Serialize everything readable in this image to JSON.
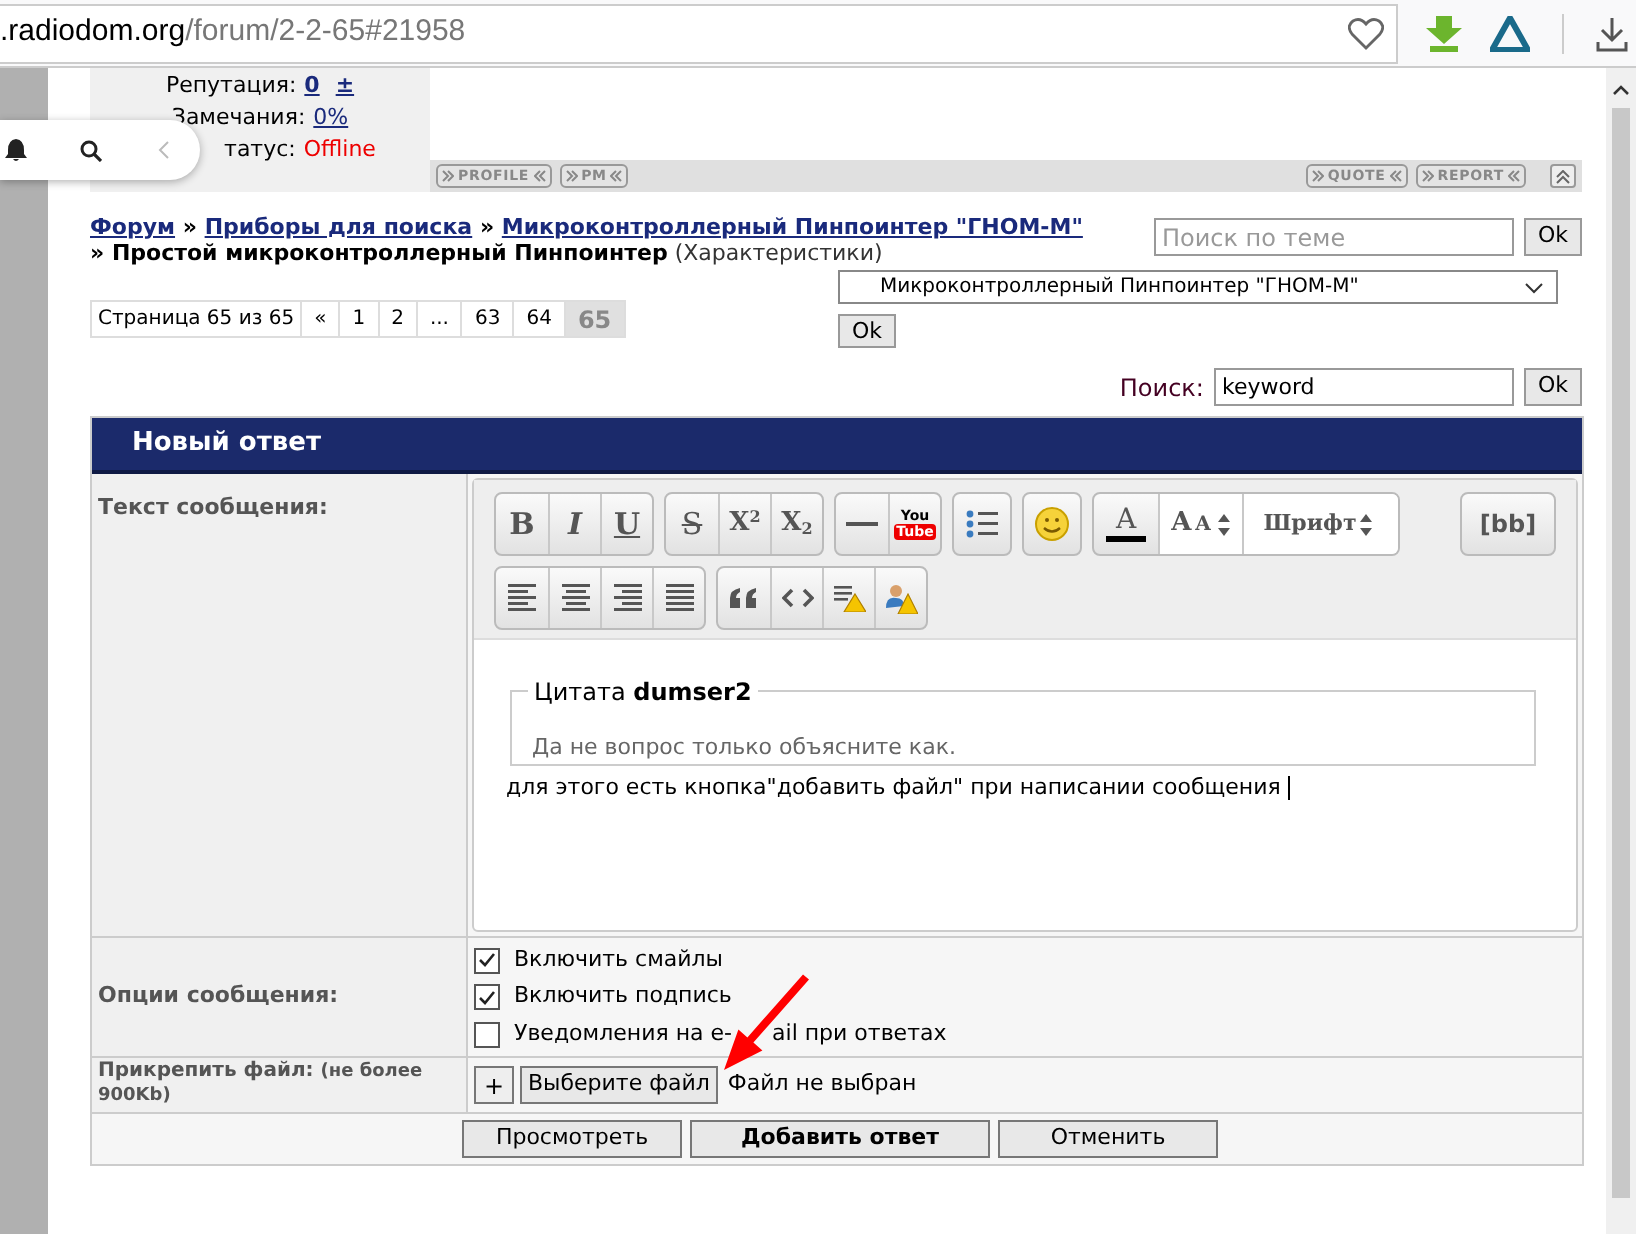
{
  "browser": {
    "url_host": ".radiodom.org",
    "url_path": "/forum/2-2-65#21958"
  },
  "post_profile": {
    "reputation_label": "Репутация:",
    "reputation_value": "0",
    "reputation_action": "±",
    "remarks_label": "Замечания:",
    "remarks_value": "0%",
    "status_label": "татус:",
    "status_value": "Offline",
    "left_buttons": [
      "PROFILE",
      "PM"
    ],
    "right_buttons": [
      "QUOTE",
      "REPORT"
    ]
  },
  "breadcrumb": [
    {
      "text": "Форум",
      "kind": "link"
    },
    {
      "text": "Приборы для поиска",
      "kind": "link"
    },
    {
      "text": "Микроконтроллерный Пинпоинтер \"ГНОМ-М\"",
      "kind": "link"
    },
    {
      "text": "Простой микроконтроллерный Пинпоинтер",
      "kind": "current"
    }
  ],
  "breadcrumb_sep": "»",
  "topic_subtitle": "(Характеристики)",
  "topic_search": {
    "placeholder": "Поиск по теме",
    "button": "Ok"
  },
  "pagination": {
    "label": "Страница 65 из 65",
    "pages": [
      {
        "label": "«",
        "selected": false
      },
      {
        "label": "1",
        "selected": false
      },
      {
        "label": "2",
        "selected": false
      },
      {
        "label": "...",
        "selected": false
      },
      {
        "label": "63",
        "selected": false
      },
      {
        "label": "64",
        "selected": false
      },
      {
        "label": "65",
        "selected": true
      }
    ]
  },
  "forum_jump": {
    "value": "Микроконтроллерный Пинпоинтер \"ГНОМ-М\"",
    "button": "Ok"
  },
  "search": {
    "label": "Поиск:",
    "value": "keyword",
    "button": "Ok"
  },
  "reply_form": {
    "title": "Новый ответ",
    "message_label": "Текст сообщения:",
    "toolbar_rows": [
      [
        [
          {
            "kind": "bold",
            "label": "B"
          },
          {
            "kind": "italic",
            "label": "I"
          },
          {
            "kind": "underline",
            "label": "U"
          }
        ],
        [
          {
            "kind": "strike",
            "label": "S"
          },
          {
            "kind": "sup",
            "label": "X",
            "index": "2"
          },
          {
            "kind": "sub",
            "label": "X",
            "index": "2"
          }
        ],
        [
          {
            "kind": "hr"
          },
          {
            "kind": "youtube",
            "label": "You",
            "label2": "Tube"
          }
        ],
        [
          {
            "kind": "list"
          }
        ],
        [
          {
            "kind": "smiley"
          }
        ],
        [
          {
            "kind": "color",
            "label": "A"
          },
          {
            "kind": "size",
            "label": "A",
            "label2": "A"
          },
          {
            "kind": "font",
            "label": "Шрифт"
          }
        ],
        [
          {
            "kind": "bb",
            "label": "[bb]"
          }
        ]
      ],
      [
        [
          {
            "kind": "align-left"
          },
          {
            "kind": "align-center"
          },
          {
            "kind": "align-right"
          },
          {
            "kind": "justify"
          }
        ],
        [
          {
            "kind": "quote"
          },
          {
            "kind": "code"
          },
          {
            "kind": "warn-text"
          },
          {
            "kind": "warn-user"
          }
        ]
      ]
    ],
    "quote": {
      "label": "Цитата",
      "author": "dumser2",
      "text": "Да не вопрос только объясните как."
    },
    "message_text": "для этого есть кнопка\"добавить файл\" при написании сообщения",
    "options_label": "Опции сообщения:",
    "options": [
      {
        "label": "Включить смайлы",
        "checked": true
      },
      {
        "label": "Включить подпись",
        "checked": true
      },
      {
        "label": "Уведомления на e-",
        "label_rest": "ail при ответах",
        "checked": false
      }
    ],
    "attach_label": "Прикрепить файл:",
    "attach_note": "(не более 900Kb)",
    "attach_add": "+",
    "choose_file": "Выберите файл",
    "no_file": "Файл не выбран",
    "buttons": [
      {
        "label": "Просмотреть",
        "primary": false
      },
      {
        "label": "Добавить ответ",
        "primary": true
      },
      {
        "label": "Отменить",
        "primary": false
      }
    ]
  }
}
